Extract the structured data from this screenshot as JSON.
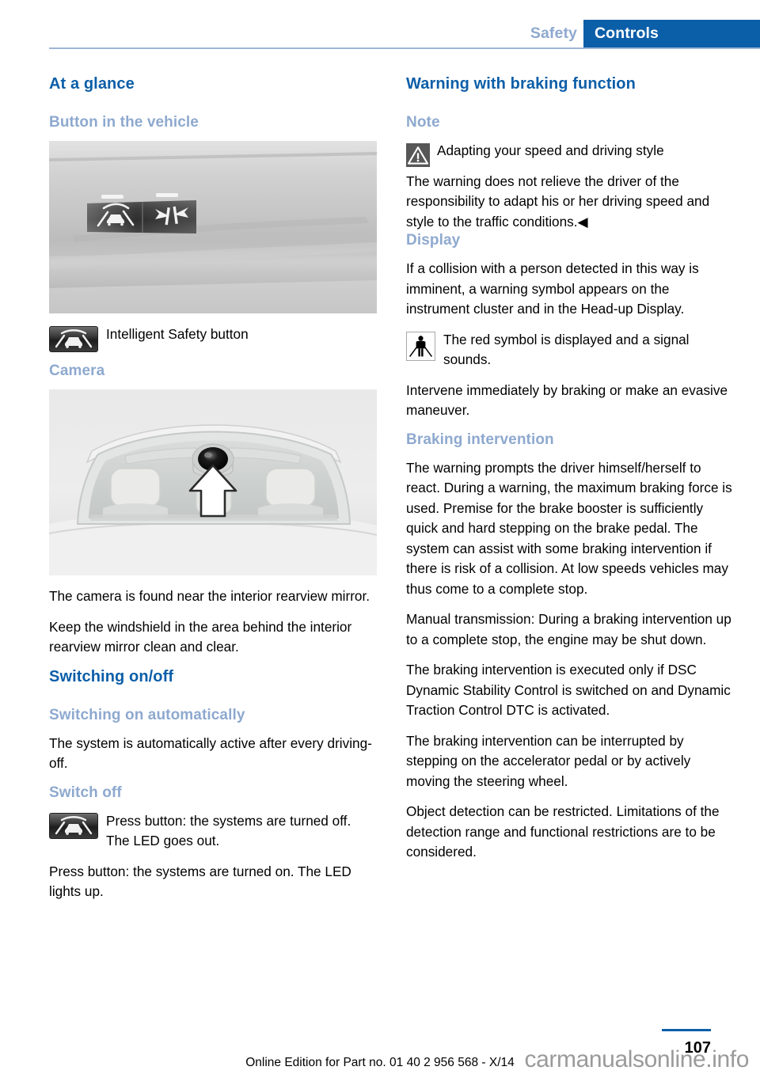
{
  "header": {
    "chapter": "Safety",
    "section": "Controls",
    "accent_blue": "#0b5ea8",
    "muted_blue": "#8ea9cf"
  },
  "left_column": {
    "h_at_a_glance": "At a glance",
    "h_button_in_the_vehicle": "Button in the vehicle",
    "figure_button_alt": "Dashboard trim with two black buttons: Intelligent Safety button and Lane Departure Warning button, each with a white LED strip above",
    "intelligent_safety_icon": "intelligent-safety-icon",
    "intelligent_safety_label": "Intelligent Safety button",
    "h_camera": "Camera",
    "figure_camera_alt": "Front view of the windshield with camera near the interior rearview mirror, white arrow pointing up to it",
    "camera_p1": "The camera is found near the interior rearview mirror.",
    "camera_p2": "Keep the windshield in the area behind the interior rearview mirror clean and clear.",
    "h_switching_on_off": "Switching on/off",
    "h_switching_on_automatically": "Switching on automatically",
    "switching_auto_p1": "The system is automatically active after every driving-off.",
    "h_switch_off": "Switch off",
    "switch_off_icon": "intelligent-safety-icon",
    "switch_off_text": "Press button: the systems are turned off. The LED goes out.",
    "switch_on_text": "Press button: the systems are turned on. The LED lights up."
  },
  "right_column": {
    "h_warning_with_braking": "Warning with braking function",
    "h_note": "Note",
    "note_icon": "warning-triangle-icon",
    "note_line1": "Adapting your speed and driving style",
    "note_body": "The warning does not relieve the driver of the responsibility to adapt his or her driving speed and style to the traffic conditions.◀",
    "h_display": "Display",
    "display_p1": "If a collision with a person detected in this way is imminent, a warning symbol appears on the instrument cluster and in the Head-up Display.",
    "display_icon": "pedestrian-warning-icon",
    "display_icon_text": "The red symbol is displayed and a signal sounds.",
    "display_p2": "Intervene immediately by braking or make an evasive maneuver.",
    "h_braking_intervention": "Braking intervention",
    "braking_p1": "The warning prompts the driver himself/herself to react. During a warning, the maximum braking force is used. Premise for the brake booster is sufficiently quick and hard stepping on the brake pedal. The system can assist with some braking intervention if there is risk of a collision. At low speeds vehicles may thus come to a complete stop.",
    "braking_p2": "Manual transmission: During a braking intervention up to a complete stop, the engine may be shut down.",
    "braking_p3": "The braking intervention is executed only if DSC Dynamic Stability Control is switched on and Dynamic Traction Control DTC is activated.",
    "braking_p4": "The braking intervention can be interrupted by stepping on the accelerator pedal or by actively moving the steering wheel.",
    "braking_p5": "Object detection can be restricted. Limitations of the detection range and functional restrictions are to be considered."
  },
  "footer": {
    "online_edition": "Online Edition for Part no. 01 40 2 956 568 - X/14",
    "page_number": "107",
    "watermark": "carmanualsonline.info"
  }
}
